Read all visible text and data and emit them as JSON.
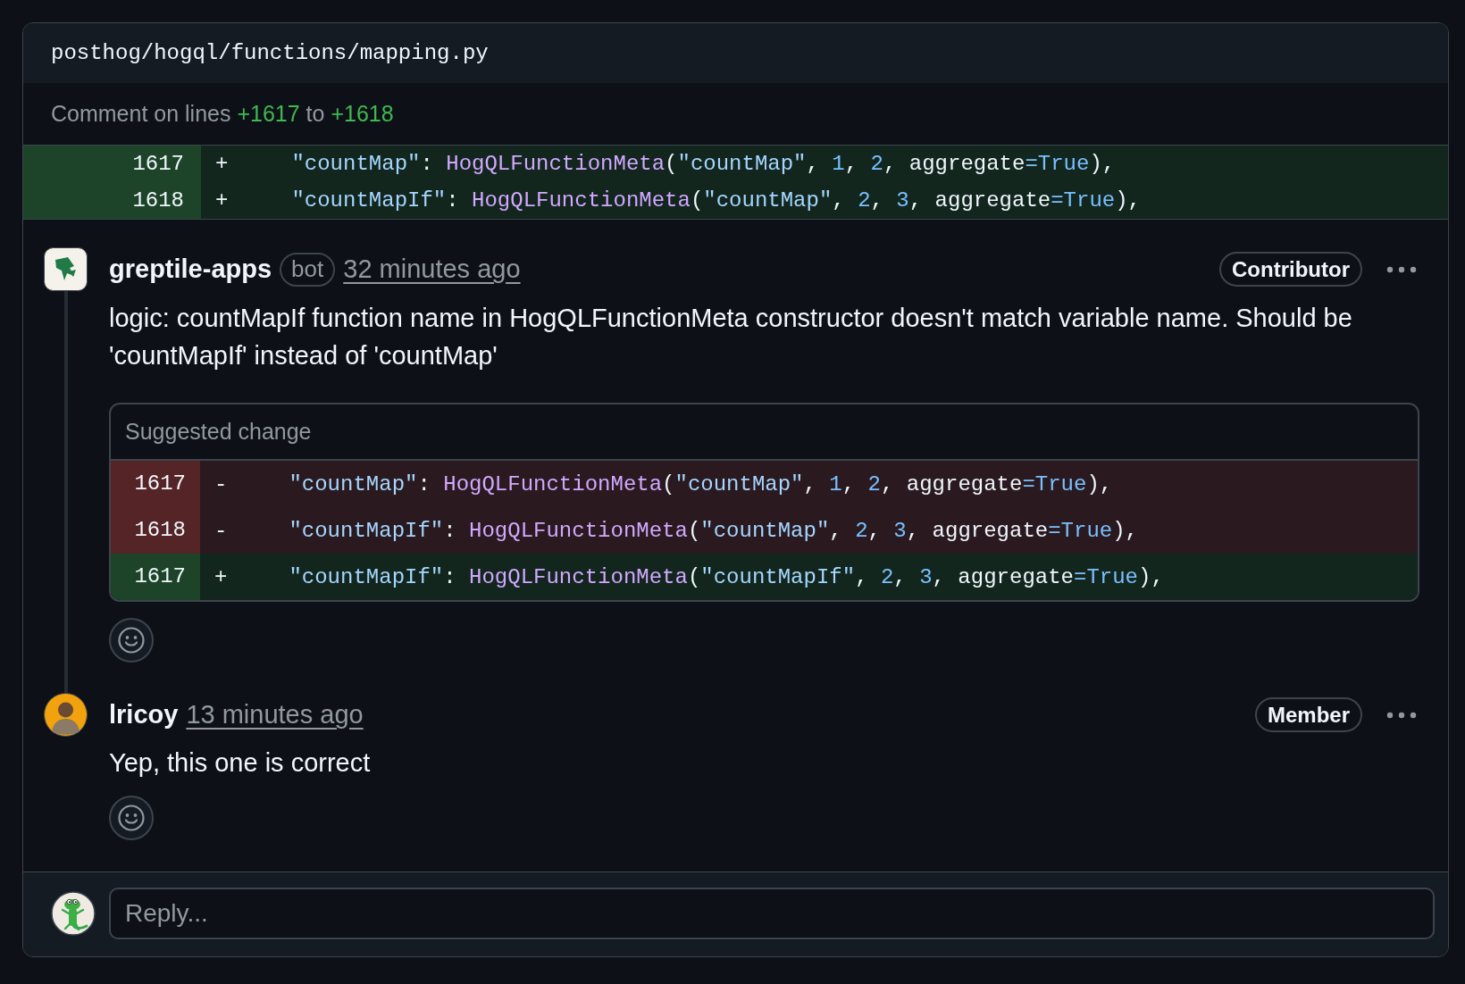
{
  "file": {
    "path": "posthog/hogql/functions/mapping.py"
  },
  "comment_range": {
    "label": "Comment on lines",
    "start": "+1617",
    "joiner": "to",
    "end": "+1618"
  },
  "diff_lines": [
    {
      "kind": "added",
      "number": "1617",
      "sign": "+",
      "tokens": [
        {
          "kind": "string",
          "text": "\"countMap\""
        },
        {
          "kind": "plain",
          "text": ": "
        },
        {
          "kind": "entity",
          "text": "HogQLFunctionMeta"
        },
        {
          "kind": "plain",
          "text": "("
        },
        {
          "kind": "string",
          "text": "\"countMap\""
        },
        {
          "kind": "plain",
          "text": ", "
        },
        {
          "kind": "constant",
          "text": "1"
        },
        {
          "kind": "plain",
          "text": ", "
        },
        {
          "kind": "constant",
          "text": "2"
        },
        {
          "kind": "plain",
          "text": ", aggregate"
        },
        {
          "kind": "constant",
          "text": "=True"
        },
        {
          "kind": "plain",
          "text": "),"
        }
      ]
    },
    {
      "kind": "added",
      "number": "1618",
      "sign": "+",
      "tokens": [
        {
          "kind": "string",
          "text": "\"countMapIf\""
        },
        {
          "kind": "plain",
          "text": ": "
        },
        {
          "kind": "entity",
          "text": "HogQLFunctionMeta"
        },
        {
          "kind": "plain",
          "text": "("
        },
        {
          "kind": "string",
          "text": "\"countMap\""
        },
        {
          "kind": "plain",
          "text": ", "
        },
        {
          "kind": "constant",
          "text": "2"
        },
        {
          "kind": "plain",
          "text": ", "
        },
        {
          "kind": "constant",
          "text": "3"
        },
        {
          "kind": "plain",
          "text": ", aggregate"
        },
        {
          "kind": "constant",
          "text": "=True"
        },
        {
          "kind": "plain",
          "text": "),"
        }
      ]
    }
  ],
  "comments": [
    {
      "avatar": {
        "kind": "logo"
      },
      "author": "greptile-apps",
      "badge": "bot",
      "time": "32 minutes ago",
      "role": "Contributor",
      "body": "logic: countMapIf function name in HogQLFunctionMeta constructor doesn't match variable name. Should be 'countMapIf' instead of 'countMap'",
      "suggestion": {
        "title": "Suggested change",
        "lines": [
          {
            "kind": "deleted",
            "number": "1617",
            "sign": "-",
            "tokens": [
              {
                "kind": "string",
                "text": "\"countMap\""
              },
              {
                "kind": "plain",
                "text": ": "
              },
              {
                "kind": "entity",
                "text": "HogQLFunctionMeta"
              },
              {
                "kind": "plain",
                "text": "("
              },
              {
                "kind": "string",
                "text": "\"countMap\""
              },
              {
                "kind": "plain",
                "text": ", "
              },
              {
                "kind": "constant",
                "text": "1"
              },
              {
                "kind": "plain",
                "text": ", "
              },
              {
                "kind": "constant",
                "text": "2"
              },
              {
                "kind": "plain",
                "text": ", aggregate"
              },
              {
                "kind": "constant",
                "text": "=True"
              },
              {
                "kind": "plain",
                "text": "),"
              }
            ]
          },
          {
            "kind": "deleted",
            "number": "1618",
            "sign": "-",
            "tokens": [
              {
                "kind": "string",
                "text": "\"countMapIf\""
              },
              {
                "kind": "plain",
                "text": ": "
              },
              {
                "kind": "entity",
                "text": "HogQLFunctionMeta"
              },
              {
                "kind": "plain",
                "text": "("
              },
              {
                "kind": "string",
                "text": "\"countMap\""
              },
              {
                "kind": "plain",
                "text": ", "
              },
              {
                "kind": "constant",
                "text": "2"
              },
              {
                "kind": "plain",
                "text": ", "
              },
              {
                "kind": "constant",
                "text": "3"
              },
              {
                "kind": "plain",
                "text": ", aggregate"
              },
              {
                "kind": "constant",
                "text": "=True"
              },
              {
                "kind": "plain",
                "text": "),"
              }
            ]
          },
          {
            "kind": "added",
            "number": "1617",
            "sign": "+",
            "tokens": [
              {
                "kind": "string",
                "text": "\"countMapIf\""
              },
              {
                "kind": "plain",
                "text": ": "
              },
              {
                "kind": "entity",
                "text": "HogQLFunctionMeta"
              },
              {
                "kind": "plain",
                "text": "("
              },
              {
                "kind": "string",
                "text": "\"countMapIf\""
              },
              {
                "kind": "plain",
                "text": ", "
              },
              {
                "kind": "constant",
                "text": "2"
              },
              {
                "kind": "plain",
                "text": ", "
              },
              {
                "kind": "constant",
                "text": "3"
              },
              {
                "kind": "plain",
                "text": ", aggregate"
              },
              {
                "kind": "constant",
                "text": "=True"
              },
              {
                "kind": "plain",
                "text": "),"
              }
            ]
          }
        ]
      }
    },
    {
      "avatar": {
        "kind": "photo"
      },
      "author": "lricoy",
      "time": "13 minutes ago",
      "role": "Member",
      "body": "Yep, this one is correct"
    }
  ],
  "reply": {
    "avatar": {
      "kind": "lizard"
    },
    "placeholder": "Reply..."
  }
}
